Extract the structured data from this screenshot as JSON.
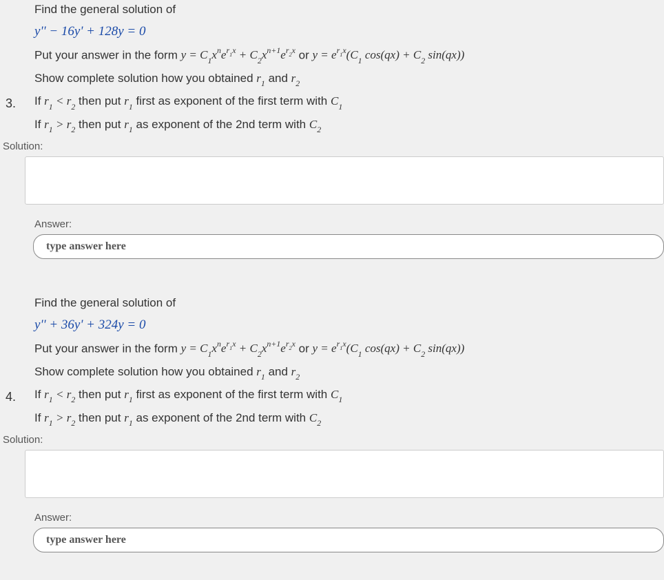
{
  "questions": [
    {
      "number": "3.",
      "prompt_intro": "Find the general solution of",
      "equation": "y'' − 16y' + 128y = 0",
      "form_line_prefix": "Put your answer in the form ",
      "form_math": "y = C₁xⁿe^{r₁x} + C₂x^{n+1}e^{r₂x}  or  y = e^{r₁x}(C₁ cos(qx) + C₂ sin(qx))",
      "show_line": "Show complete solution how you obtained r₁ and r₂",
      "cond1": "If r₁ < r₂ then put r₁ first as exponent of the first term with C₁",
      "cond2": "If r₁ > r₂ then put r₁ as exponent of the 2nd term with C₂",
      "solution_label": "Solution:",
      "answer_label": "Answer:",
      "answer_placeholder": "type answer here"
    },
    {
      "number": "4.",
      "prompt_intro": "Find the general solution of",
      "equation": "y'' + 36y' + 324y = 0",
      "form_line_prefix": "Put your answer in the form ",
      "form_math": "y = C₁xⁿe^{r₁x} + C₂x^{n+1}e^{r₂x}  or  y = e^{r₁x}(C₁ cos(qx) + C₂ sin(qx))",
      "show_line": "Show complete solution how you obtained r₁ and r₂",
      "cond1": "If r₁ < r₂ then put r₁ first as exponent of the first term with C₁",
      "cond2": "If r₁ > r₂ then put r₁ as exponent of the 2nd term with C₂",
      "solution_label": "Solution:",
      "answer_label": "Answer:",
      "answer_placeholder": "type answer here"
    }
  ]
}
